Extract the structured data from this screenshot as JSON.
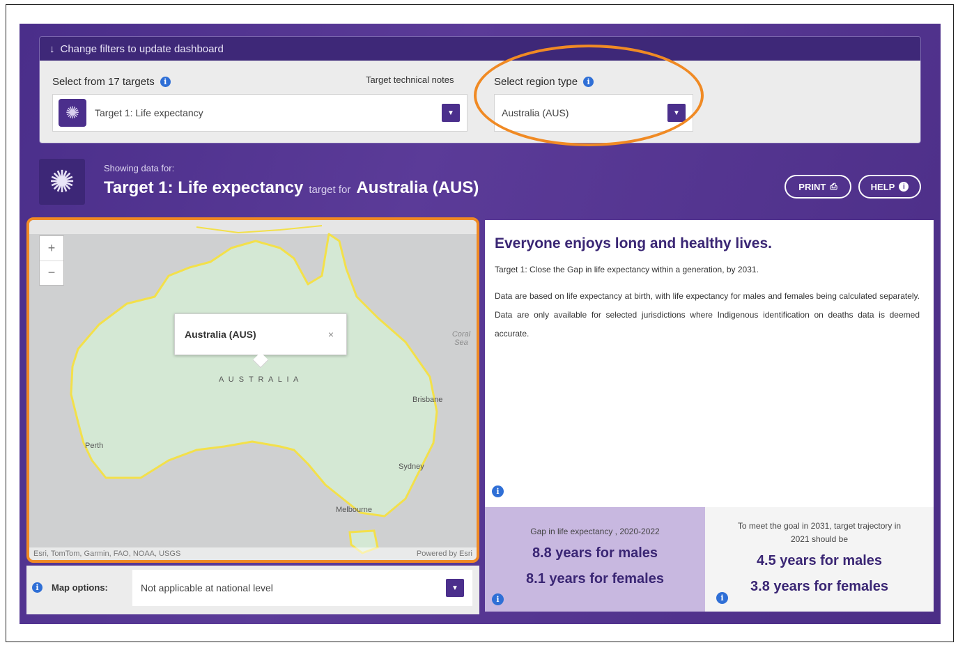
{
  "filters": {
    "banner": "Change filters to update dashboard",
    "targets_label": "Select from 17 targets",
    "notes_label": "Target technical notes",
    "target_value": "Target 1: Life expectancy",
    "region_label": "Select region type",
    "region_value": "Australia (AUS)"
  },
  "header": {
    "showing_label": "Showing data for:",
    "target": "Target 1: Life expectancy",
    "target_for": "target for",
    "region": "Australia (AUS)",
    "print_label": "PRINT",
    "help_label": "HELP"
  },
  "map": {
    "zoom_in": "+",
    "zoom_out": "−",
    "popup_title": "Australia (AUS)",
    "popup_close": "×",
    "country_label": "A U S T R A L I A",
    "coral_sea": "Coral Sea",
    "cities": [
      "Perth",
      "Brisbane",
      "Sydney",
      "Melbourne"
    ],
    "attribution": "Esri, TomTom, Garmin, FAO, NOAA, USGS",
    "powered": "Powered by Esri",
    "options_label": "Map options:",
    "options_value": "Not applicable at national level"
  },
  "description": {
    "heading": "Everyone enjoys long and healthy lives.",
    "target_text": "Target 1: Close the Gap in life expectancy within a generation, by 2031.",
    "body": "Data are based on life expectancy at birth, with life expectancy for males and females being calculated separately. Data are only available for selected jurisdictions where Indigenous identification on deaths data is deemed accurate."
  },
  "stats": {
    "gap_label": "Gap in life expectancy , 2020-2022",
    "gap_males": "8.8 years for males",
    "gap_females": "8.1 years for females",
    "goal_label": "To meet the goal in 2031, target trajectory in 2021 should be",
    "goal_males": "4.5 years for males",
    "goal_females": "3.8 years for females"
  },
  "colors": {
    "brand": "#4b2f8c",
    "accent": "#f08a24",
    "info": "#2f6fd6",
    "land": "#d4e8d4",
    "coast": "#f3e04a"
  }
}
